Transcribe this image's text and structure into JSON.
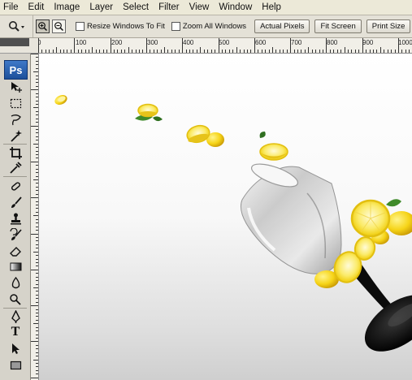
{
  "menubar": {
    "items": [
      "File",
      "Edit",
      "Image",
      "Layer",
      "Select",
      "Filter",
      "View",
      "Window",
      "Help"
    ]
  },
  "options": {
    "tool_icon": "zoom-icon",
    "zoom_in_icon": "zoom-in-icon",
    "zoom_out_icon": "zoom-out-icon",
    "resize_windows_label": "Resize Windows To Fit",
    "resize_windows_checked": false,
    "zoom_all_label": "Zoom All Windows",
    "zoom_all_checked": false,
    "actual_pixels_label": "Actual Pixels",
    "fit_screen_label": "Fit Screen",
    "print_size_label": "Print Size"
  },
  "ruler": {
    "h_labels": [
      "0",
      "100",
      "200",
      "300",
      "400",
      "500",
      "600",
      "700",
      "800",
      "900",
      "1000"
    ],
    "v_labels": [
      "0",
      "1",
      "2",
      "3",
      "4",
      "5",
      "6",
      "7",
      "8",
      "9"
    ]
  },
  "toolbox": {
    "logo": "Ps",
    "tools": [
      "move-icon",
      "marquee-icon",
      "lasso-icon",
      "magic-wand-icon",
      "crop-icon",
      "eyedropper-icon",
      "healing-brush-icon",
      "brush-icon",
      "clone-stamp-icon",
      "history-brush-icon",
      "eraser-icon",
      "gradient-icon",
      "blur-icon",
      "dodge-icon",
      "pen-icon",
      "type-icon",
      "path-selection-icon",
      "rectangle-icon"
    ],
    "type_glyph": "T"
  },
  "colors": {
    "lemon": "#f2d21a",
    "leaf": "#3f8a2a",
    "glass_base": "#0b0b0b",
    "ps_blue": "#2a62b5"
  }
}
